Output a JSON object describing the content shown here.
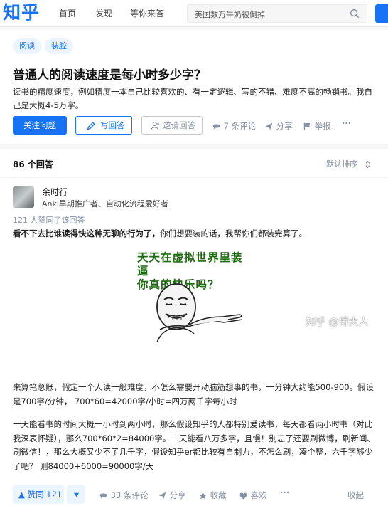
{
  "header": {
    "logo": "知乎",
    "nav": [
      "首页",
      "发现",
      "等你来答"
    ],
    "search_placeholder": "美国数万牛奶被倒掉"
  },
  "question": {
    "tags": [
      "阅读",
      "装腔"
    ],
    "title": "普通人的阅读速度是每小时多少字？",
    "description": "读书的精度速度，例如精度一本自己比较喜欢的、有一定逻辑、写的不错、难度不高的畅销书。我自己是大概4-5万字。",
    "follow_label": "关注问题",
    "write_label": "写回答",
    "invite_label": "邀请回答",
    "comments_label": "7 条评论",
    "share_label": "分享",
    "report_label": "举报",
    "more_label": "···"
  },
  "answers": {
    "count_label": "86 个回答",
    "sort_label": "默认排序",
    "author": "余时行",
    "bio": "Anki早期推广者、自动化流程爱好者",
    "agree_note": "121 人赞同了该回答",
    "lead_bold": "看不下去比谁读得快这种无聊的行为了，",
    "lead_rest": "你们想要装的话，我帮你们都装完算了。",
    "meme_line1": "天天在虚拟世界里装逼",
    "meme_line2": "你真的快乐吗？",
    "para1": "来算笔总账，假定一个人读一般难度，不怎么需要开动脑筋想事的书，一分钟大约能500-900。假设是700字/分钟，  700*60=42000字/小时=四万两千字每小时",
    "para2": "一天能看书的时间大概一小时到两小时，那么假设知乎的人都特别爱读书，每天都看两小时书（对此我深表怀疑），那么700*60*2=84000字。一天能看八万多字，且慢！别忘了还要刷微博，刷新闻、刷微信！，那么大概又少不了几千字，假设知乎er都比较有自制力，不怎么刷，凑个整，六千字够少了吧？ 则84000+6000=90000字/天"
  },
  "actionbar": {
    "vote_up": "▲ 赞同 121",
    "comments": "33 条评论",
    "share": "分享",
    "collect": "收藏",
    "like": "喜欢",
    "more": "···",
    "collapse": "收起"
  },
  "watermark": "知乎 @博大人",
  "colors": {
    "brand": "#1772f6",
    "meta": "#8590a6",
    "meme_text": "#1d6b10"
  }
}
